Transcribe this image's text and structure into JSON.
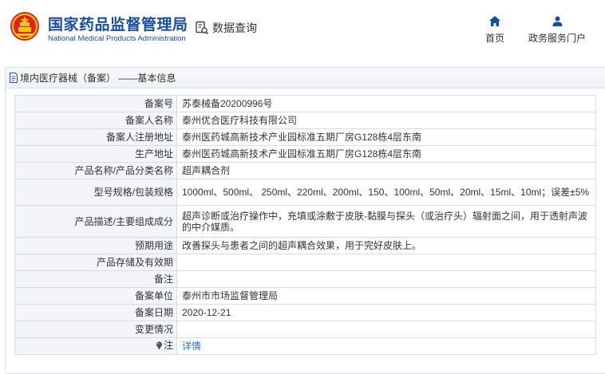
{
  "header": {
    "brand_cn": "国家药品监督管理局",
    "brand_en": "National Medical Products Administration",
    "data_query": "数据查询",
    "nav_home": "首页",
    "nav_portal": "政务服务门户",
    "accent_color": "#1a4d9c"
  },
  "section": {
    "title": "境内医疗器械（备案） ——基本信息"
  },
  "rows": [
    {
      "label": "备案号",
      "value": "苏泰械备20200996号"
    },
    {
      "label": "备案人名称",
      "value": "泰州优合医疗科技有限公司"
    },
    {
      "label": "备案人注册地址",
      "value": "泰州医药城高新技术产业园标准五期厂房G128栋4层东南"
    },
    {
      "label": "生产地址",
      "value": "泰州医药城高新技术产业园标准五期厂房G128栋4层东南"
    },
    {
      "label": "产品名称/产品分类名称",
      "value": "超声耦合剂"
    },
    {
      "label": "型号规格/包装规格",
      "value": "1000ml、500ml、 250ml、220ml、200ml、150、100ml、50ml、20ml、15ml、10ml；误差±5%"
    },
    {
      "label": "产品描述/主要组成成分",
      "value": "超声诊断或治疗操作中，充填或涂敷于皮肤-黏膜与探头（或治疗头）辐射面之间，用于透射声波的中介媒质。"
    },
    {
      "label": "预期用途",
      "value": "改善探头与患者之间的超声耦合效果，用于完好皮肤上。"
    },
    {
      "label": "产品存储及有效期",
      "value": ""
    },
    {
      "label": "备注",
      "value": ""
    },
    {
      "label": "备案单位",
      "value": "泰州市市场监督管理局"
    },
    {
      "label": "备案日期",
      "value": "2020-12-21"
    },
    {
      "label": "变更情况",
      "value": ""
    }
  ],
  "note_row": {
    "label": "注",
    "link": "详情"
  }
}
